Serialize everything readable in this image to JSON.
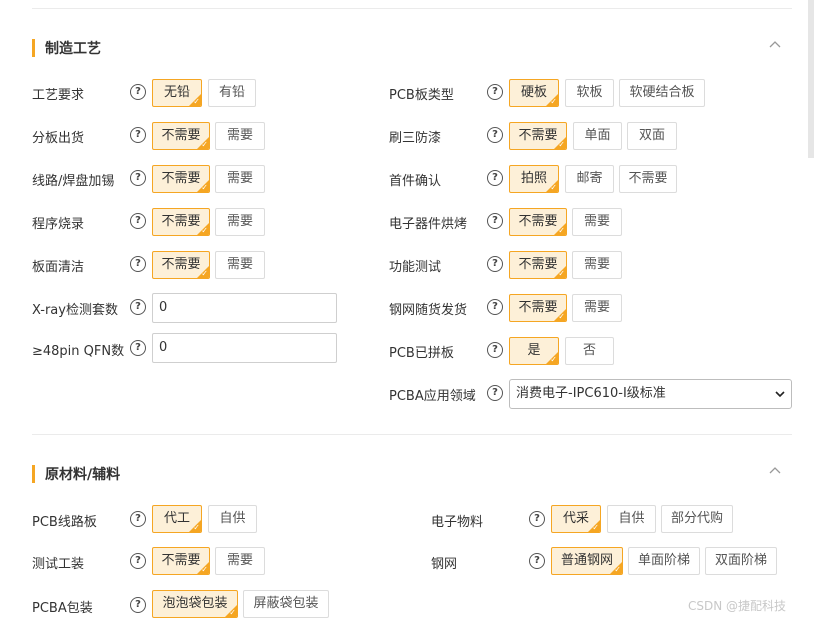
{
  "section1": {
    "title": "制造工艺",
    "left": [
      {
        "label": "工艺要求",
        "options": [
          "无铅",
          "有铅"
        ],
        "selected": 0
      },
      {
        "label": "分板出货",
        "options": [
          "不需要",
          "需要"
        ],
        "selected": 0
      },
      {
        "label": "线路/焊盘加锡",
        "options": [
          "不需要",
          "需要"
        ],
        "selected": 0
      },
      {
        "label": "程序烧录",
        "options": [
          "不需要",
          "需要"
        ],
        "selected": 0
      },
      {
        "label": "板面清洁",
        "options": [
          "不需要",
          "需要"
        ],
        "selected": 0
      },
      {
        "label": "X-ray检测套数",
        "value": "0"
      },
      {
        "label": "≥48pin QFN数",
        "value": "0"
      }
    ],
    "right": [
      {
        "label": "PCB板类型",
        "options": [
          "硬板",
          "软板",
          "软硬结合板"
        ],
        "selected": 0
      },
      {
        "label": "刷三防漆",
        "options": [
          "不需要",
          "单面",
          "双面"
        ],
        "selected": 0
      },
      {
        "label": "首件确认",
        "options": [
          "拍照",
          "邮寄",
          "不需要"
        ],
        "selected": 0
      },
      {
        "label": "电子器件烘烤",
        "options": [
          "不需要",
          "需要"
        ],
        "selected": 0
      },
      {
        "label": "功能测试",
        "options": [
          "不需要",
          "需要"
        ],
        "selected": 0
      },
      {
        "label": "钢网随货发货",
        "options": [
          "不需要",
          "需要"
        ],
        "selected": 0
      },
      {
        "label": "PCB已拼板",
        "options": [
          "是",
          "否"
        ],
        "selected": 0
      },
      {
        "label": "PCBA应用领域",
        "select_value": "消费电子-IPC610-I级标准"
      }
    ]
  },
  "section2": {
    "title": "原材料/辅料",
    "left": [
      {
        "label": "PCB线路板",
        "options": [
          "代工",
          "自供"
        ],
        "selected": 0
      },
      {
        "label": "测试工装",
        "options": [
          "不需要",
          "需要"
        ],
        "selected": 0
      },
      {
        "label": "PCBA包装",
        "options": [
          "泡泡袋包装",
          "屏蔽袋包装"
        ],
        "selected": 0
      }
    ],
    "right": [
      {
        "label": "电子物料",
        "options": [
          "代采",
          "自供",
          "部分代购"
        ],
        "selected": 0
      },
      {
        "label": "钢网",
        "options": [
          "普通钢网",
          "单面阶梯",
          "双面阶梯"
        ],
        "selected": 0
      }
    ]
  },
  "icons": {
    "help": "?",
    "check": "✓"
  },
  "watermark": "CSDN @捷配科技",
  "colors": {
    "accent": "#f5a623",
    "selected_bg": "#fdf0d8"
  }
}
